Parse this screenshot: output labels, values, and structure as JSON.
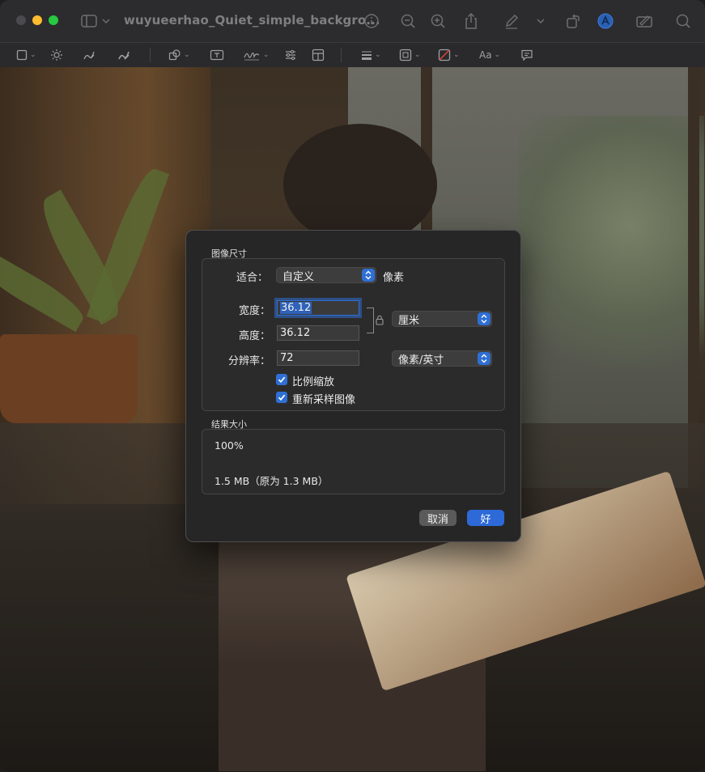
{
  "window": {
    "title": "wuyueerhao_Quiet_simple_backgro..."
  },
  "markup_toolbar": {
    "font_button": "Aa"
  },
  "dialog": {
    "section_title": "图像尺寸",
    "fit_label": "适合：",
    "fit_value": "自定义",
    "fit_unit": "像素",
    "width_label": "宽度：",
    "width_value": "36.12",
    "height_label": "高度：",
    "height_value": "36.12",
    "size_unit_value": "厘米",
    "resolution_label": "分辨率：",
    "resolution_value": "72",
    "resolution_unit_value": "像素/英寸",
    "scale_proportionally": "比例缩放",
    "resample_image": "重新采样图像",
    "result_title": "结果大小",
    "result_percent": "100%",
    "result_size": "1.5 MB（原为 1.3 MB）",
    "cancel_button": "取消",
    "ok_button": "好"
  },
  "colors": {
    "accent": "#2d6ad8",
    "dialog_bg": "#272626"
  }
}
